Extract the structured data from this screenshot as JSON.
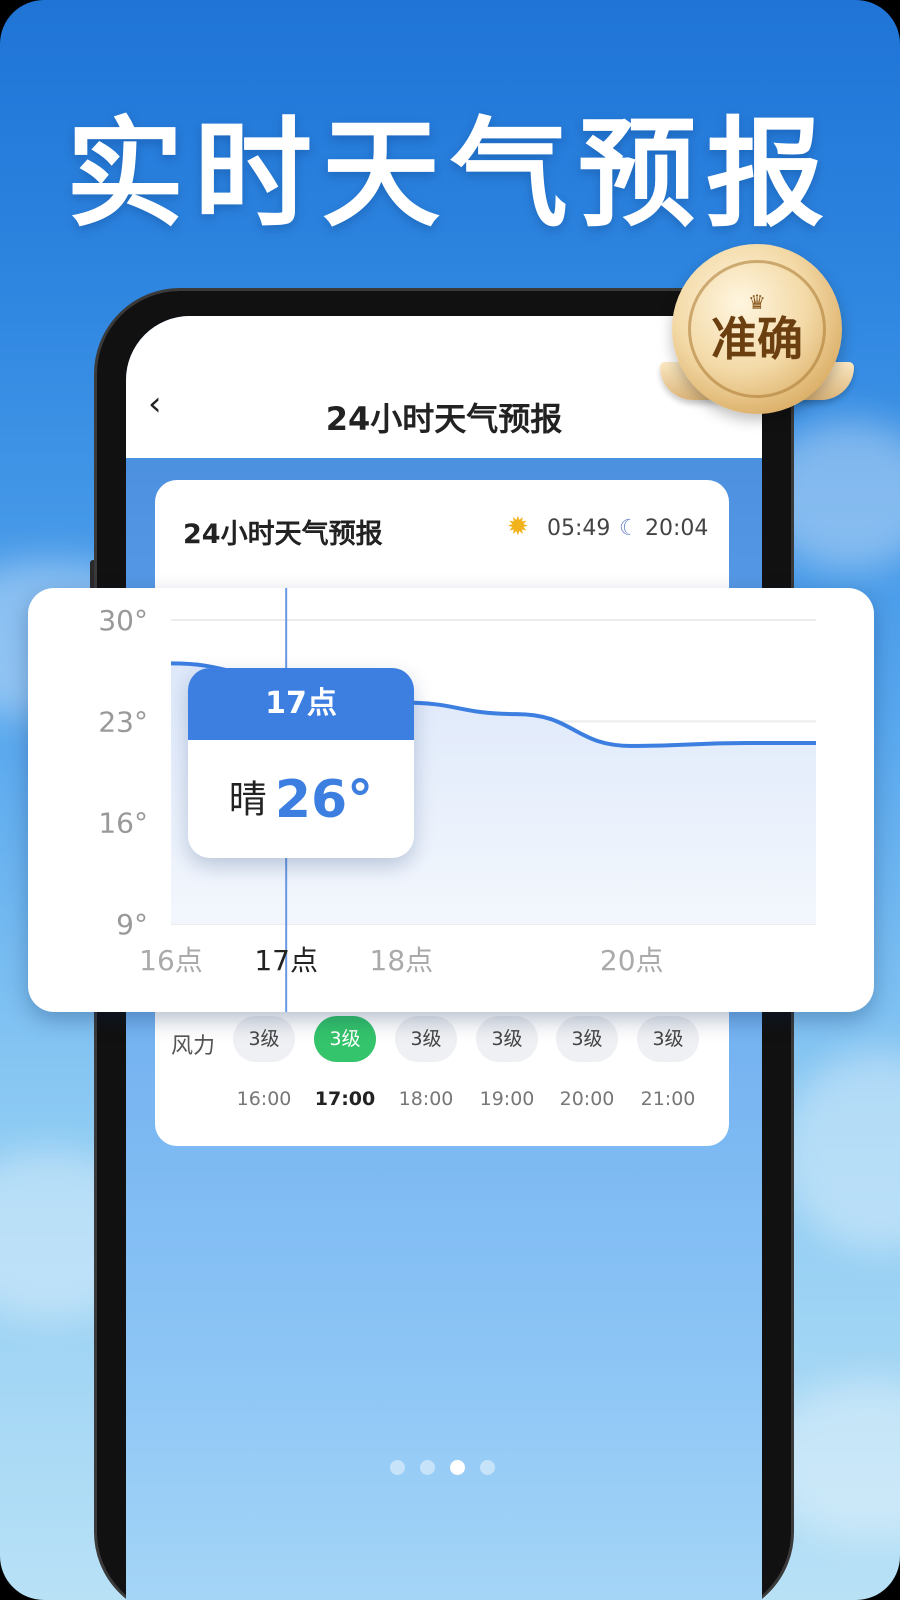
{
  "headline": "实时天气预报",
  "badge": {
    "text": "准确",
    "icon": "crown-icon"
  },
  "nav": {
    "back_icon": "chevron-left-icon",
    "title": "24小时天气预报"
  },
  "card": {
    "title": "24小时天气预报",
    "sunrise": "05:49",
    "sunset": "20:04",
    "sun_icon": "sun-icon",
    "moon_icon": "moon-icon"
  },
  "wind": {
    "label": "风力",
    "items": [
      {
        "level": "3级",
        "time": "16:00",
        "active": false
      },
      {
        "level": "3级",
        "time": "17:00",
        "active": true
      },
      {
        "level": "3级",
        "time": "18:00",
        "active": false
      },
      {
        "level": "3级",
        "time": "19:00",
        "active": false
      },
      {
        "level": "3级",
        "time": "20:00",
        "active": false
      },
      {
        "level": "3级",
        "time": "21:00",
        "active": false
      }
    ]
  },
  "tooltip": {
    "hour": "17点",
    "condition": "晴",
    "temp": "26°"
  },
  "pager": {
    "count": 4,
    "active_index": 2
  },
  "colors": {
    "accent": "#3c7fe1",
    "wind_active": "#34c46b"
  },
  "chart_data": {
    "type": "line",
    "x": [
      16,
      17,
      18,
      19,
      20,
      21
    ],
    "x_tick_labels": [
      "16点",
      "17点",
      "18点",
      "20点"
    ],
    "x_tick_positions": [
      16,
      17,
      18,
      20
    ],
    "y_ticks": [
      9,
      16,
      23,
      30
    ],
    "y_tick_labels": [
      "30°",
      "23°",
      "16°",
      "9°"
    ],
    "ylim": [
      9,
      30
    ],
    "xlim": [
      16,
      21.6
    ],
    "series": [
      {
        "values": [
          27,
          26,
          24.3,
          23.5,
          21.3,
          21.5
        ]
      }
    ],
    "selected_x": 17,
    "area_fill": true,
    "grid": true
  }
}
